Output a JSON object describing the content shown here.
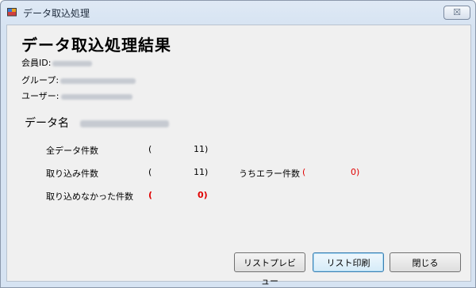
{
  "window": {
    "title": "データ取込処理",
    "close_symbol": "☒"
  },
  "header": {
    "title": "データ取込処理結果"
  },
  "info": {
    "member_id_label": "会員ID:",
    "group_label": "グループ:",
    "user_label": "ユーザー:"
  },
  "data_name": {
    "label": "データ名"
  },
  "stats": {
    "all_label": "全データ件数",
    "all_count": "11)",
    "imported_label": "取り込み件数",
    "imported_count": "11)",
    "error_label": "うちエラー件数",
    "error_count": "0)",
    "not_imported_label": "取り込めなかった件数",
    "not_imported_count": "0)",
    "open_paren": "("
  },
  "buttons": {
    "preview": "リストプレビュー",
    "print": "リスト印刷",
    "close": "閉じる"
  },
  "colors": {
    "error": "#e00000",
    "focus_border": "#3c7fb1"
  }
}
